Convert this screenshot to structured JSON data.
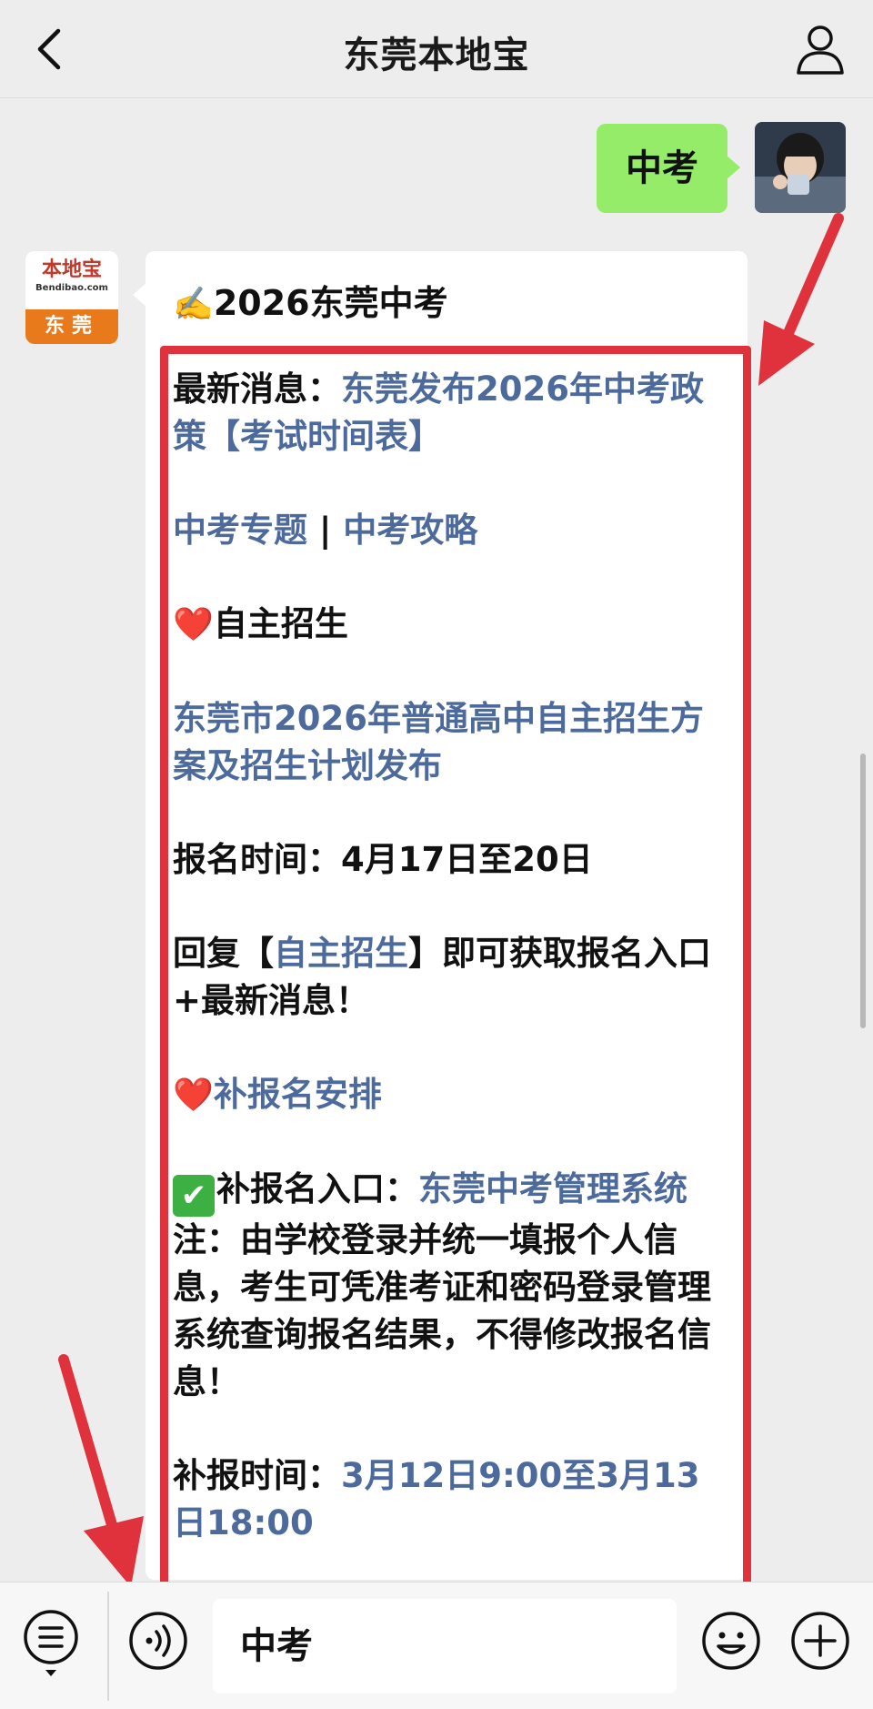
{
  "nav": {
    "title": "东莞本地宝"
  },
  "sent_message": {
    "text": "中考"
  },
  "bot": {
    "logo_text": "本地宝",
    "logo_sub": "Bendibao.com",
    "city": "东莞"
  },
  "reply": {
    "title_emoji": "✍️",
    "title": "2026东莞中考",
    "latest_label": "最新消息：",
    "latest_link": "东莞发布2026年中考政策【考试时间表】",
    "topic_link": "中考专题",
    "separator": " | ",
    "guide_link": "中考攻略",
    "heart_emoji": "❤️",
    "section1_title": "自主招生",
    "plan_link": "东莞市2026年普通高中自主招生方案及招生计划发布",
    "signup_time": "报名时间：4月17日至20日",
    "reply_prefix": "回复【",
    "reply_keyword": "自主招生",
    "reply_suffix": "】即可获取报名入口+最新消息！",
    "section2_link": "补报名安排",
    "check_emoji": "✔",
    "entry_label": "补报名入口：",
    "entry_link": "东莞中考管理系统",
    "note": "注：由学校登录并统一填报个人信息，考生可凭准考证和密码登录管理系统查询报名结果，不得修改报名信息！",
    "makeup_label": "补报时间：",
    "makeup_time": "3月12日9:00至3月13日18:00"
  },
  "input_bar": {
    "text": "中考"
  },
  "colors": {
    "sent_bubble": "#95ec69",
    "link": "#4d6a9c",
    "highlight": "#e0323c",
    "brand_orange": "#e87a1c"
  },
  "icons": [
    "back-chevron-icon",
    "user-profile-icon",
    "menu-list-icon",
    "voice-icon",
    "emoji-face-icon",
    "plus-circle-icon",
    "red-arrow-icon"
  ]
}
